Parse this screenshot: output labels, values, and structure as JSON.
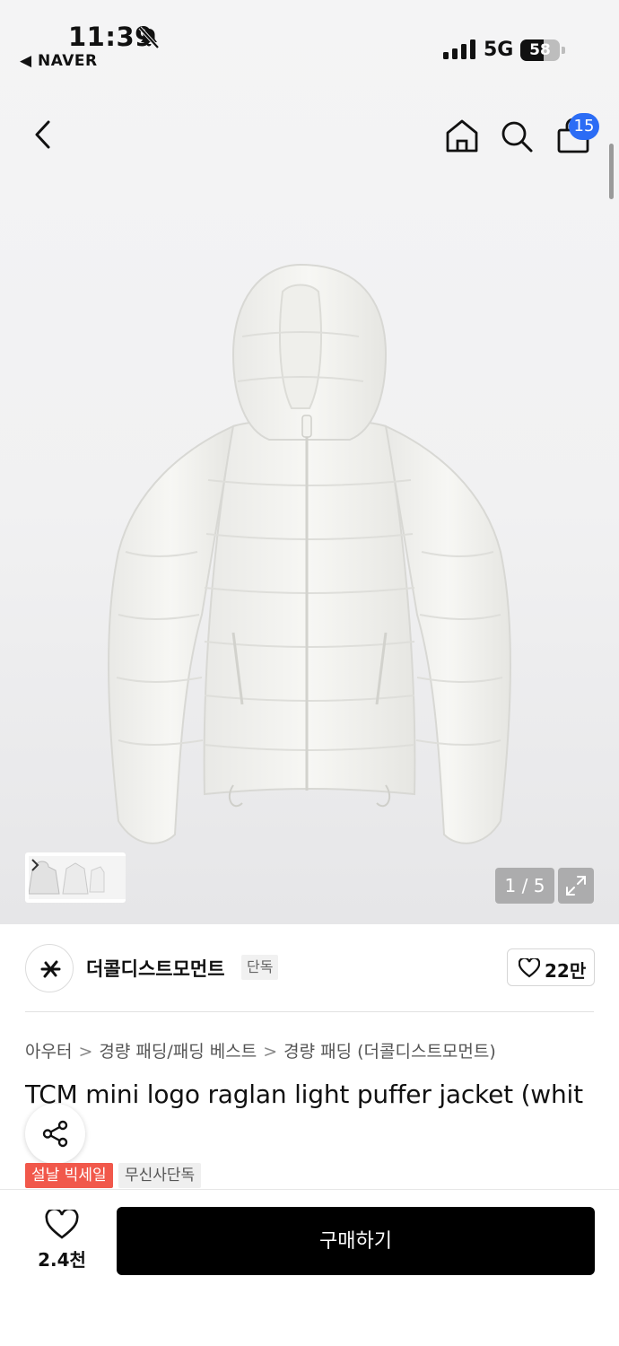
{
  "status_bar": {
    "time": "11:39",
    "back_app": "◀ NAVER",
    "network": "5G",
    "battery": "58",
    "battery_level": 0.58
  },
  "header": {
    "cart_count": "15"
  },
  "gallery": {
    "counter": "1 / 5"
  },
  "brand": {
    "name": "더콜디스트모먼트",
    "tag": "단독",
    "likes": "22만"
  },
  "breadcrumb": [
    "아우터",
    "경량 패딩/패딩 베스트",
    "경량 패딩 (더콜디스트모먼트)"
  ],
  "product": {
    "title": "TCM mini logo raglan light puffer jacket (whit",
    "tags": {
      "sale": "설날 빅세일",
      "exclusive": "무신사단독"
    }
  },
  "bottom_bar": {
    "wish_count": "2.4천",
    "buy_label": "구매하기"
  },
  "colors": {
    "accent_blue": "#2b6cf5",
    "sale_red": "#f1584b",
    "buy_button": "#000000"
  }
}
